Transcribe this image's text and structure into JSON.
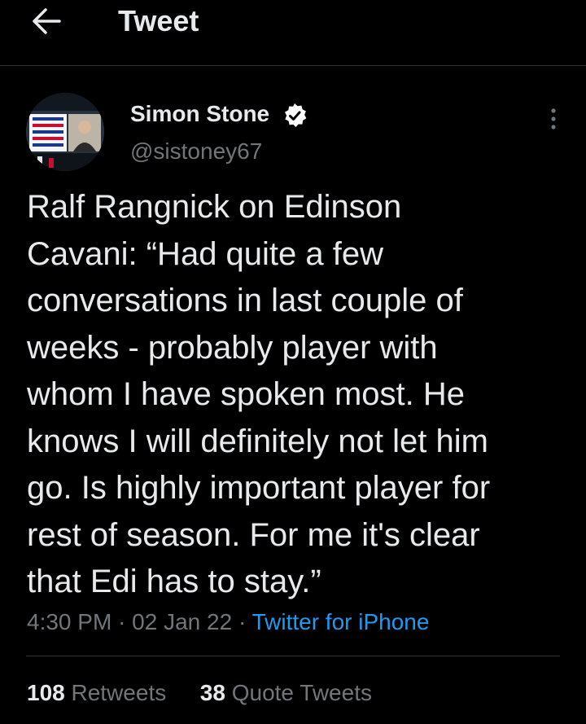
{
  "header": {
    "title": "Tweet",
    "back_icon": "arrow-left-icon"
  },
  "tweet": {
    "author": {
      "display_name": "Simon Stone",
      "handle": "@sistoney67",
      "verified": true,
      "verified_icon": "verified-badge-icon",
      "avatar_icon": "avatar-image"
    },
    "more_icon": "more-vertical-icon",
    "text": "Ralf Rangnick on Edinson\nCavani: “Had quite a few\nconversations in last couple of\nweeks - probably player with\nwhom I have spoken most. He\nknows I will definitely not let him\ngo. Is highly important player for\nrest of season. For me it's clear\nthat Edi has to stay.”",
    "time": "4:30 PM",
    "date": "02 Jan 22",
    "separator": "·",
    "source": "Twitter for iPhone"
  },
  "stats": {
    "retweets_count": "108",
    "retweets_label": "Retweets",
    "quotes_count": "38",
    "quotes_label": "Quote Tweets"
  },
  "colors": {
    "background": "#000000",
    "primary_text": "#e7e9ea",
    "secondary_text": "#71767b",
    "link": "#1d9bf0",
    "divider": "#2f3336"
  }
}
